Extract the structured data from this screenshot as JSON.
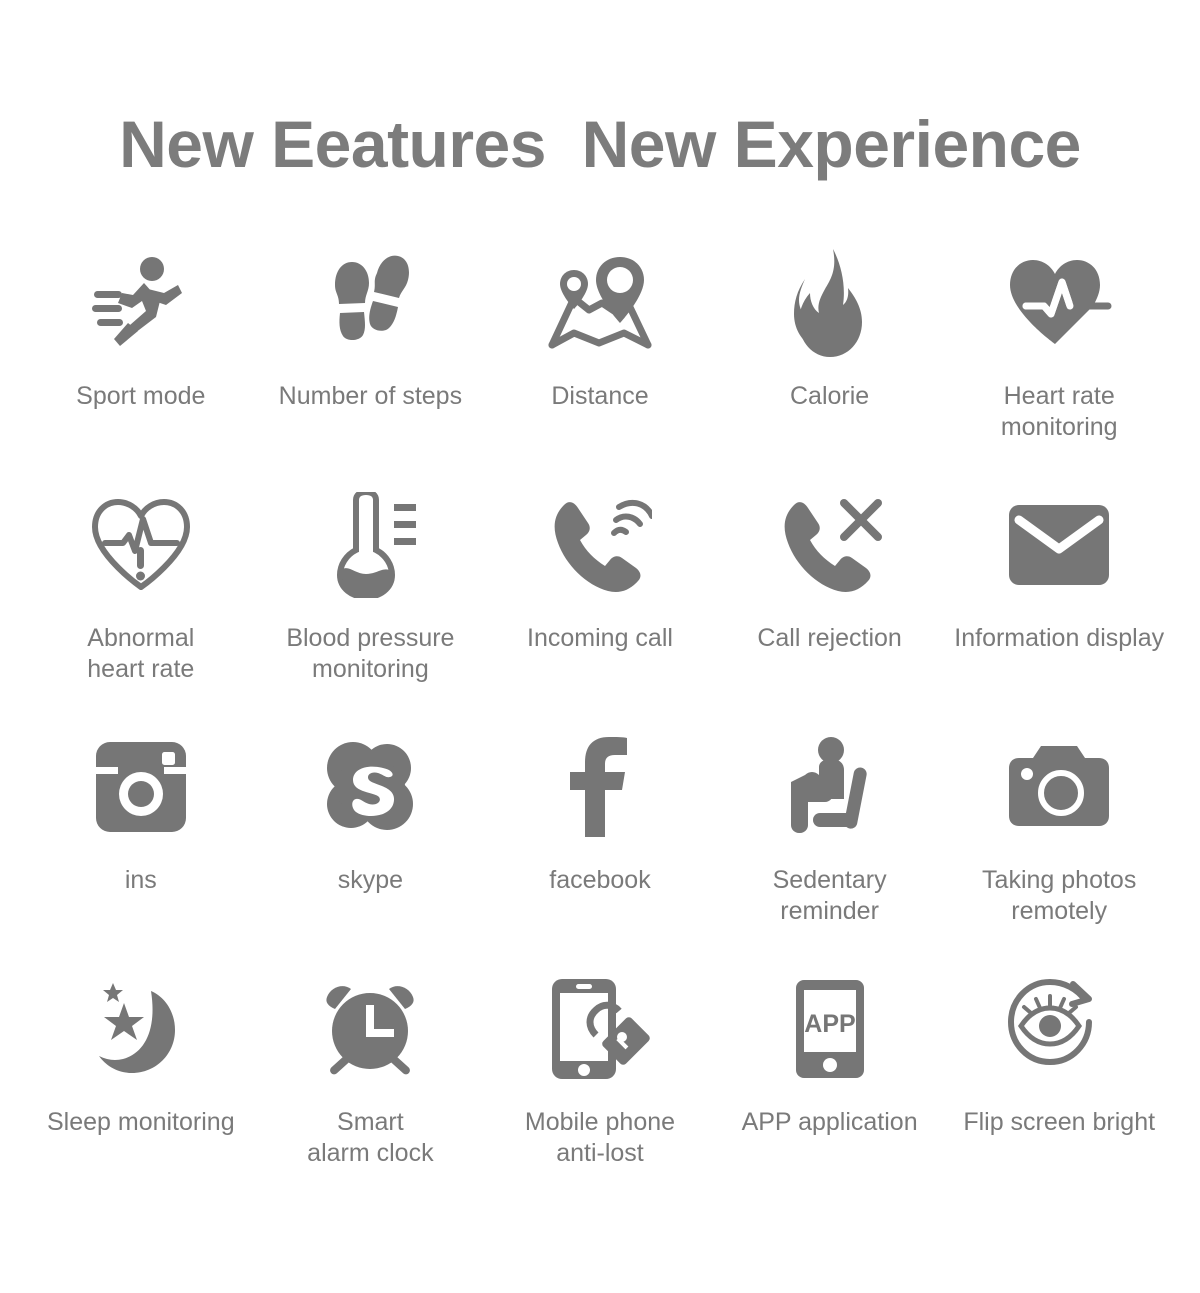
{
  "page": {
    "background_color": "#ffffff",
    "icon_color": "#767676",
    "label_color": "#7a7a7a",
    "title_color": "#7c7c7c"
  },
  "header": {
    "title": "New Eeatures  New Experience"
  },
  "features": [
    {
      "icon": "running-person-icon",
      "label": "Sport mode"
    },
    {
      "icon": "footprints-icon",
      "label": "Number of steps"
    },
    {
      "icon": "map-route-pins-icon",
      "label": "Distance"
    },
    {
      "icon": "flame-icon",
      "label": "Calorie"
    },
    {
      "icon": "heart-pulse-filled-icon",
      "label": "Heart rate\nmonitoring"
    },
    {
      "icon": "heart-pulse-outline-alert-icon",
      "label": "Abnormal\nheart rate"
    },
    {
      "icon": "thermometer-icon",
      "label": "Blood pressure\nmonitoring"
    },
    {
      "icon": "phone-ringing-icon",
      "label": "Incoming call"
    },
    {
      "icon": "phone-reject-icon",
      "label": "Call rejection"
    },
    {
      "icon": "envelope-icon",
      "label": "Information display"
    },
    {
      "icon": "instagram-icon",
      "label": "ins"
    },
    {
      "icon": "skype-icon",
      "label": "skype"
    },
    {
      "icon": "facebook-icon",
      "label": "facebook"
    },
    {
      "icon": "person-sitting-icon",
      "label": "Sedentary\nreminder"
    },
    {
      "icon": "camera-icon",
      "label": "Taking photos\nremotely"
    },
    {
      "icon": "moon-stars-icon",
      "label": "Sleep monitoring"
    },
    {
      "icon": "alarm-clock-icon",
      "label": "Smart\nalarm clock"
    },
    {
      "icon": "phone-lock-icon",
      "label": "Mobile phone\nanti-lost"
    },
    {
      "icon": "phone-app-icon",
      "label": "APP application",
      "screen_text": "APP"
    },
    {
      "icon": "eye-rotate-icon",
      "label": "Flip screen bright"
    }
  ]
}
